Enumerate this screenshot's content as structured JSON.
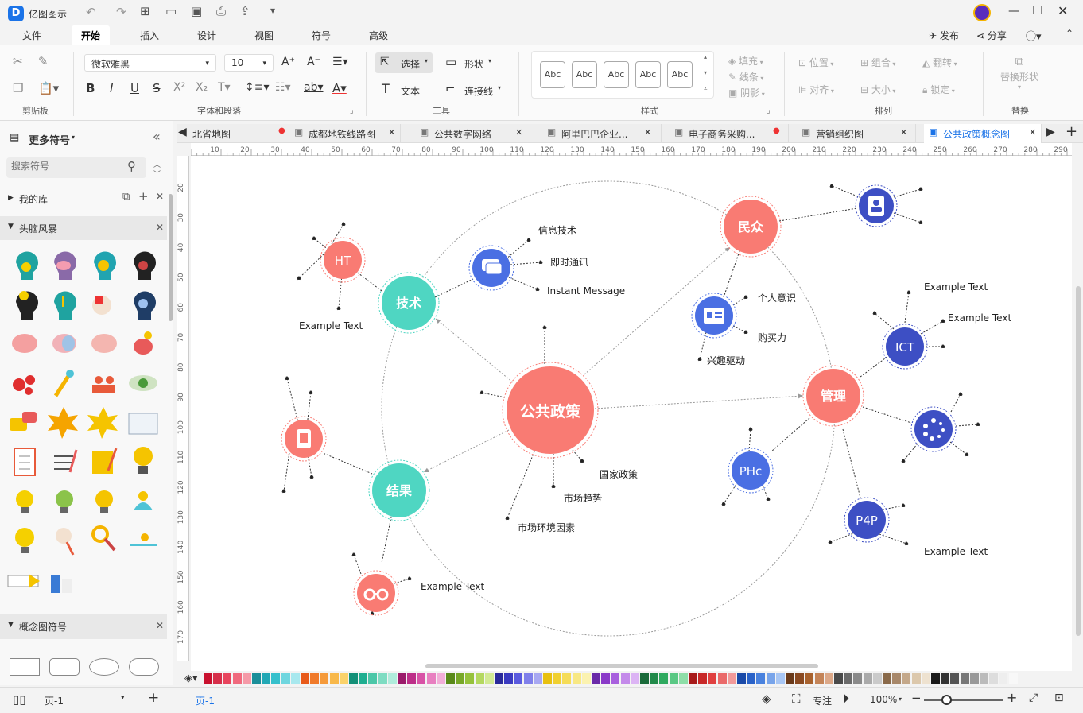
{
  "app": {
    "title": "亿图图示"
  },
  "menu": {
    "tabs": [
      "文件",
      "开始",
      "插入",
      "设计",
      "视图",
      "符号",
      "高级"
    ],
    "publish": "发布",
    "share": "分享"
  },
  "ribbon": {
    "groups": {
      "clipboard": "剪贴板",
      "font": "字体和段落",
      "tools": "工具",
      "styles": "样式",
      "arrange": "排列",
      "replace": "替换"
    },
    "font_name": "微软雅黑",
    "font_size": "10",
    "select": "选择",
    "shape": "形状",
    "text": "文本",
    "connector": "连接线",
    "style_label": "Abc",
    "fill": "填充",
    "line": "线条",
    "shadow": "阴影",
    "position": "位置",
    "group": "组合",
    "flip": "翻转",
    "align": "对齐",
    "size": "大小",
    "lock": "锁定",
    "replace_shape": "替换形状"
  },
  "sidebar": {
    "title": "更多符号",
    "search_placeholder": "搜索符号",
    "my_lib": "我的库",
    "section1": "头脑风暴",
    "section2": "概念图符号"
  },
  "doc_tabs": [
    "北省地图",
    "成都地铁线路图",
    "公共数字网络",
    "阿里巴巴企业...",
    "电子商务采购...",
    "营销组织图",
    "公共政策概念图"
  ],
  "ruler": {
    "h": [
      "10",
      "20",
      "30",
      "40",
      "50",
      "60",
      "70",
      "80",
      "90",
      "100",
      "110",
      "120",
      "130",
      "140",
      "150",
      "160",
      "170",
      "180",
      "190",
      "200",
      "210",
      "220",
      "230",
      "240",
      "250",
      "260",
      "270",
      "280",
      "290"
    ],
    "v": [
      "20",
      "30",
      "40",
      "50",
      "60",
      "70",
      "80",
      "90",
      "100",
      "110",
      "120",
      "130",
      "140",
      "150",
      "160",
      "170",
      "180"
    ]
  },
  "diagram": {
    "center": "公共政策",
    "nodes": {
      "tech": "技术",
      "result": "结果",
      "people": "民众",
      "manage": "管理",
      "ht": "HT",
      "ict": "ICT",
      "phc": "PHc",
      "p4p": "P4P"
    },
    "labels": {
      "l1": "信息技术",
      "l2": "即时通讯",
      "l3": "Instant Message",
      "l4": "Example Text",
      "l5": "个人意识",
      "l6": "购买力",
      "l7": "兴趣驱动",
      "l8": "Example Text",
      "l9": "Example Text",
      "l10": "国家政策",
      "l11": "市场趋势",
      "l12": "市场环境因素",
      "l13": "Example Text",
      "l14": "Example Text"
    },
    "colors": {
      "coral": "#f97b73",
      "teal": "#4fd6c2",
      "blue": "#4a6fe3",
      "darkblue": "#3d4fc4"
    }
  },
  "status": {
    "page_left": "页-1",
    "page_tab": "页-1",
    "focus": "专注",
    "zoom": "100%"
  }
}
